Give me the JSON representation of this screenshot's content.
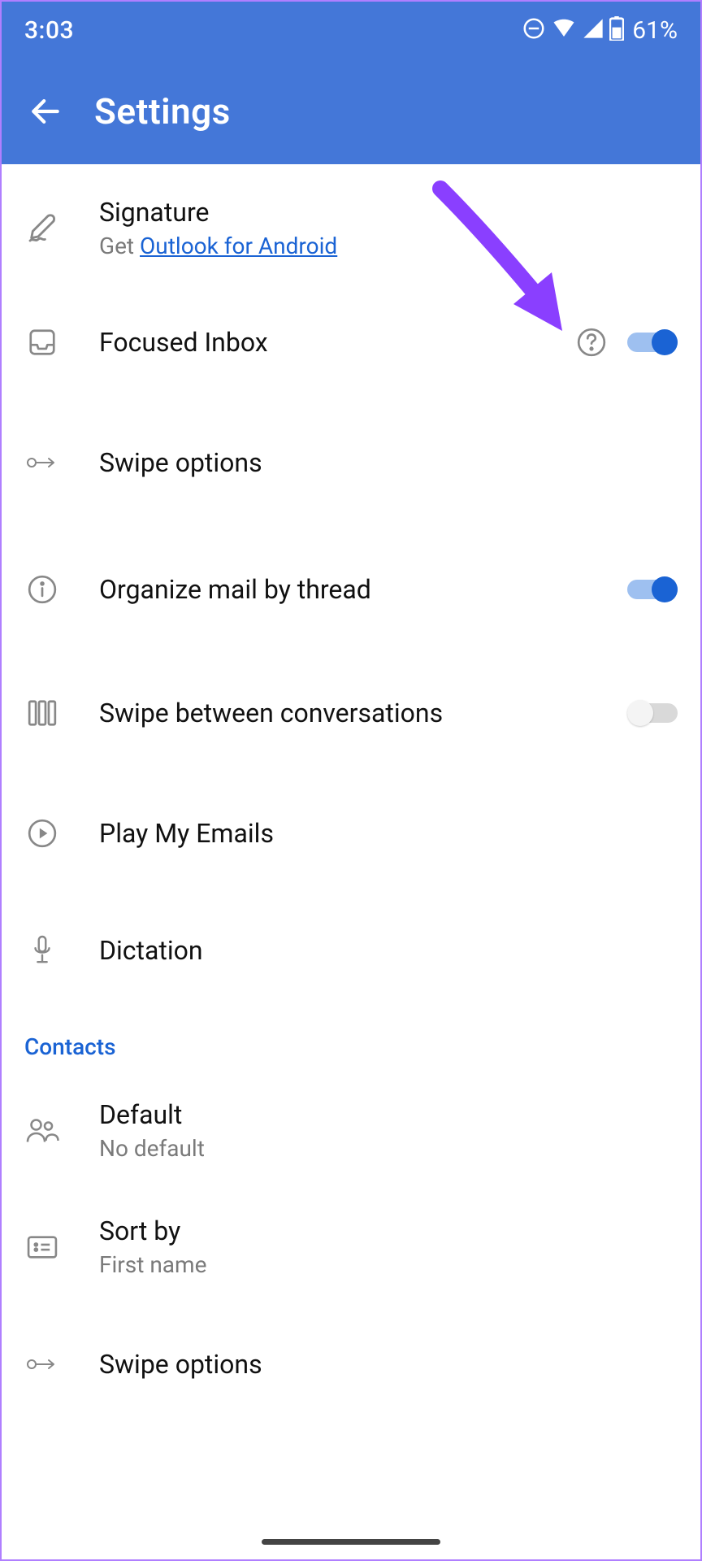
{
  "status": {
    "time": "3:03",
    "battery_pct": "61%"
  },
  "appbar": {
    "title": "Settings"
  },
  "mail": {
    "signature": {
      "title": "Signature",
      "sub_prefix": "Get ",
      "link": "Outlook for Android"
    },
    "focused": {
      "title": "Focused Inbox"
    },
    "swipe": {
      "title": "Swipe options"
    },
    "organize": {
      "title": "Organize mail by thread"
    },
    "swipe_conv": {
      "title": "Swipe between conversations"
    },
    "play": {
      "title": "Play My Emails"
    },
    "dictation": {
      "title": "Dictation"
    }
  },
  "contacts_header": "Contacts",
  "contacts": {
    "default": {
      "title": "Default",
      "sub": "No default"
    },
    "sort": {
      "title": "Sort by",
      "sub": "First name"
    },
    "swipe": {
      "title": "Swipe options"
    }
  }
}
